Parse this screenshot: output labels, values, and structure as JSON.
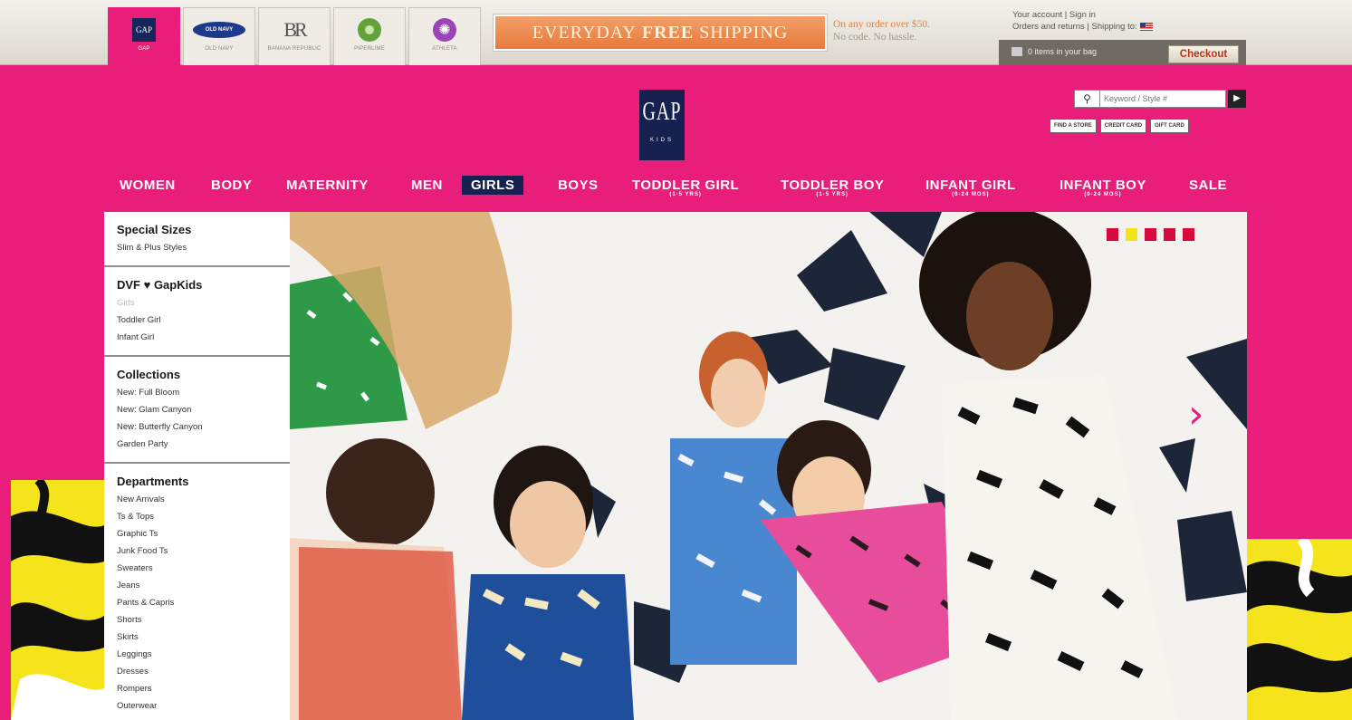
{
  "brand_tabs": [
    {
      "label": "GAP",
      "logo": "GAP",
      "active": true
    },
    {
      "label": "OLD NAVY",
      "logo": "OLD NAVY",
      "active": false
    },
    {
      "label": "BANANA REPUBLIC",
      "logo": "BR",
      "active": false
    },
    {
      "label": "PIPERLIME",
      "logo": "",
      "active": false
    },
    {
      "label": "ATHLETA",
      "logo": "",
      "active": false
    }
  ],
  "promo": {
    "pre": "EVERYDAY",
    "bold": "FREE",
    "post": "SHIPPING",
    "line1": "On any order over $50.",
    "line2": "No code. No hassle."
  },
  "account": {
    "your_account": "Your account",
    "sign_in": "Sign in",
    "orders": "Orders and returns",
    "shipping_to": "Shipping to:",
    "bag_text": "0 items in your bag",
    "checkout": "Checkout"
  },
  "header": {
    "logo_main": "GAP",
    "logo_sub": "KIDS",
    "search_placeholder": "Keyword / Style #",
    "utility": [
      "FIND A STORE",
      "CREDIT CARD",
      "GIFT CARD"
    ]
  },
  "nav": [
    {
      "label": "WOMEN",
      "sub": ""
    },
    {
      "label": "BODY",
      "sub": ""
    },
    {
      "label": "MATERNITY",
      "sub": ""
    },
    {
      "label": "MEN",
      "sub": ""
    },
    {
      "label": "GIRLS",
      "sub": "",
      "active": true
    },
    {
      "label": "BOYS",
      "sub": ""
    },
    {
      "label": "TODDLER GIRL",
      "sub": "(1-5 YRS)"
    },
    {
      "label": "TODDLER BOY",
      "sub": "(1-5 YRS)"
    },
    {
      "label": "INFANT GIRL",
      "sub": "(0-24 MOS)"
    },
    {
      "label": "INFANT BOY",
      "sub": "(0-24 MOS)"
    },
    {
      "label": "SALE",
      "sub": ""
    }
  ],
  "sidebar": [
    {
      "title": "Special Sizes",
      "links": [
        {
          "text": "Slim & Plus Styles"
        }
      ]
    },
    {
      "title": "DVF ♥ GapKids",
      "links": [
        {
          "text": "Girls",
          "muted": true
        },
        {
          "text": "Toddler Girl"
        },
        {
          "text": "Infant Girl"
        }
      ]
    },
    {
      "title": "Collections",
      "links": [
        {
          "text": "New: Full Bloom"
        },
        {
          "text": "New: Glam Canyon"
        },
        {
          "text": "New: Butterfly Canyon"
        },
        {
          "text": "Garden Party"
        }
      ]
    },
    {
      "title": "Departments",
      "links": [
        {
          "text": "New Arrivals"
        },
        {
          "text": "Ts & Tops"
        },
        {
          "text": "Graphic Ts"
        },
        {
          "text": "Junk Food Ts"
        },
        {
          "text": "Sweaters"
        },
        {
          "text": "Jeans"
        },
        {
          "text": "Pants & Capris"
        },
        {
          "text": "Shorts"
        },
        {
          "text": "Skirts"
        },
        {
          "text": "Leggings"
        },
        {
          "text": "Dresses"
        },
        {
          "text": "Rompers"
        },
        {
          "text": "Outerwear"
        }
      ]
    }
  ],
  "carousel": {
    "count": 5,
    "active_index": 1
  },
  "colors": {
    "brand_pink": "#e91e7a",
    "navy": "#17214f",
    "promo_orange": "#e8793a",
    "dot_red": "#d60a3c",
    "dot_yellow": "#f3e41a"
  }
}
